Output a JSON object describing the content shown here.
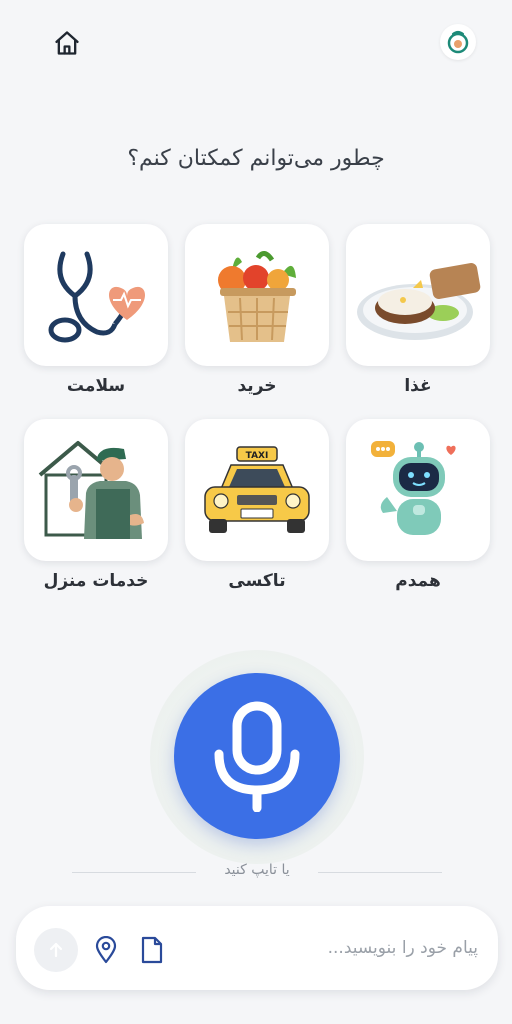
{
  "header": {
    "home_icon": "home-icon",
    "logo_icon": "app-logo-icon"
  },
  "prompt": "چطور می‌توانم کمکتان کنم؟",
  "services": [
    {
      "id": "food",
      "label": "غذا",
      "icon": "food-plate-icon"
    },
    {
      "id": "shopping",
      "label": "خرید",
      "icon": "vegetable-basket-icon"
    },
    {
      "id": "health",
      "label": "سلامت",
      "icon": "stethoscope-heart-icon"
    },
    {
      "id": "companion",
      "label": "همدم",
      "icon": "robot-companion-icon"
    },
    {
      "id": "taxi",
      "label": "تاکسی",
      "icon": "taxi-icon"
    },
    {
      "id": "home_services",
      "label": "خدمات منزل",
      "icon": "repairman-icon"
    }
  ],
  "voice": {
    "icon": "microphone-icon"
  },
  "or_type": "یا تایپ کنید",
  "composer": {
    "placeholder": "پیام خود را بنویسید...",
    "value": "",
    "send_icon": "arrow-up-icon",
    "location_icon": "location-pin-icon",
    "attach_icon": "document-icon"
  },
  "taxi_sign": "TAXI",
  "colors": {
    "accent": "#3b6fe6",
    "background": "#f5f6f8",
    "card": "#ffffff",
    "icon_dark": "#1f3a5f"
  }
}
